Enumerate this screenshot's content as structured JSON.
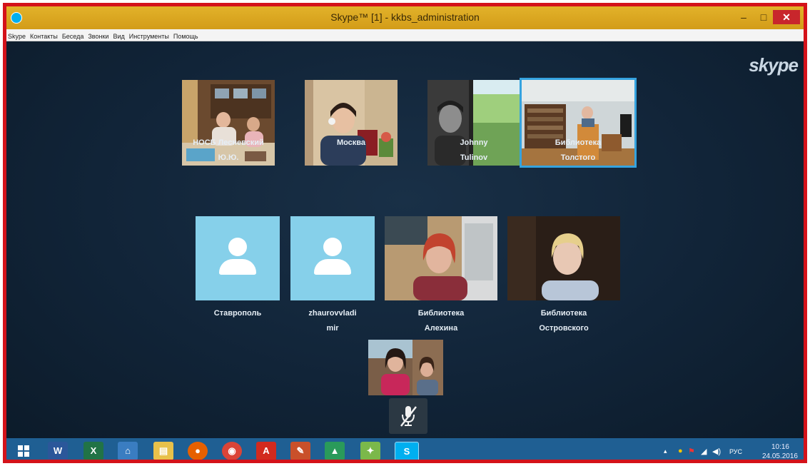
{
  "window": {
    "title": "Skype™ [1] - kkbs_administration",
    "minimize": "–",
    "maximize": "□",
    "close": "✕"
  },
  "menu": [
    "Skype",
    "Контакты",
    "Беседа",
    "Звонки",
    "Вид",
    "Инструменты",
    "Помощь"
  ],
  "brand_logo": "skype",
  "participants": [
    {
      "name_line1": "НОСБ Лесневский",
      "name_line2": "Ю.Ю."
    },
    {
      "name_line1": "Москва",
      "name_line2": ""
    },
    {
      "name_line1": "Johnny",
      "name_line2": "Tulinov"
    },
    {
      "name_line1": "Библиотека",
      "name_line2": "Толстого"
    },
    {
      "name_line1": "Ставрополь",
      "name_line2": ""
    },
    {
      "name_line1": "zhaurovvladi",
      "name_line2": "mir"
    },
    {
      "name_line1": "Библиотека",
      "name_line2": "Алехина"
    },
    {
      "name_line1": "Библиотека",
      "name_line2": "Островского"
    }
  ],
  "controls": {
    "mute_icon": "microphone-muted-icon"
  },
  "taskbar": {
    "apps": [
      "word-icon",
      "excel-icon",
      "network-icon",
      "file-explorer-icon",
      "firefox-icon",
      "chrome-icon",
      "acrobat-icon",
      "paint-icon",
      "drive-icon",
      "puzzle-icon",
      "skype-icon"
    ],
    "language": "РУС",
    "time": "10:16",
    "date": "24.05.2016"
  },
  "colors": {
    "frame_border": "#d4121a",
    "titlebar": "#d9a51c",
    "stage": "#112438",
    "taskbar": "#1f5f93",
    "avatar_bg": "#86d0ea",
    "active_tile": "#35a3df"
  }
}
